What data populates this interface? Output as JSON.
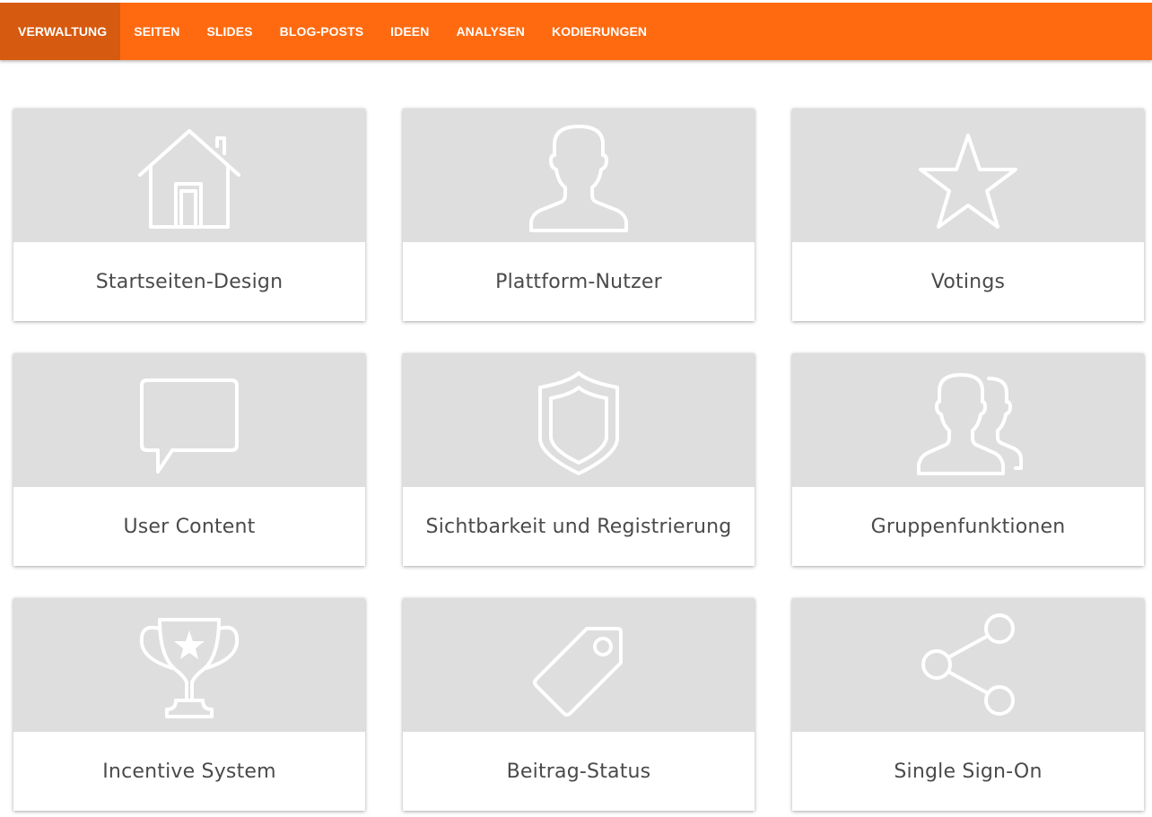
{
  "nav": {
    "items": [
      {
        "label": "VERWALTUNG",
        "active": true
      },
      {
        "label": "SEITEN",
        "active": false
      },
      {
        "label": "SLIDES",
        "active": false
      },
      {
        "label": "BLOG-POSTS",
        "active": false
      },
      {
        "label": "IDEEN",
        "active": false
      },
      {
        "label": "ANALYSEN",
        "active": false
      },
      {
        "label": "KODIERUNGEN",
        "active": false
      }
    ]
  },
  "colors": {
    "navbar": "#ff6a10",
    "navbar_active": "#d65a0f",
    "card_header": "#dedede",
    "card_text": "#4a4a4a",
    "icon": "#ffffff"
  },
  "cards": [
    {
      "label": "Startseiten-Design",
      "icon": "home-icon"
    },
    {
      "label": "Plattform-Nutzer",
      "icon": "user-icon"
    },
    {
      "label": "Votings",
      "icon": "star-icon"
    },
    {
      "label": "User Content",
      "icon": "speech-bubble-icon"
    },
    {
      "label": "Sichtbarkeit und Registrierung",
      "icon": "shield-icon"
    },
    {
      "label": "Gruppenfunktionen",
      "icon": "users-group-icon"
    },
    {
      "label": "Incentive System",
      "icon": "trophy-icon"
    },
    {
      "label": "Beitrag-Status",
      "icon": "tag-icon"
    },
    {
      "label": "Single Sign-On",
      "icon": "share-icon"
    }
  ]
}
